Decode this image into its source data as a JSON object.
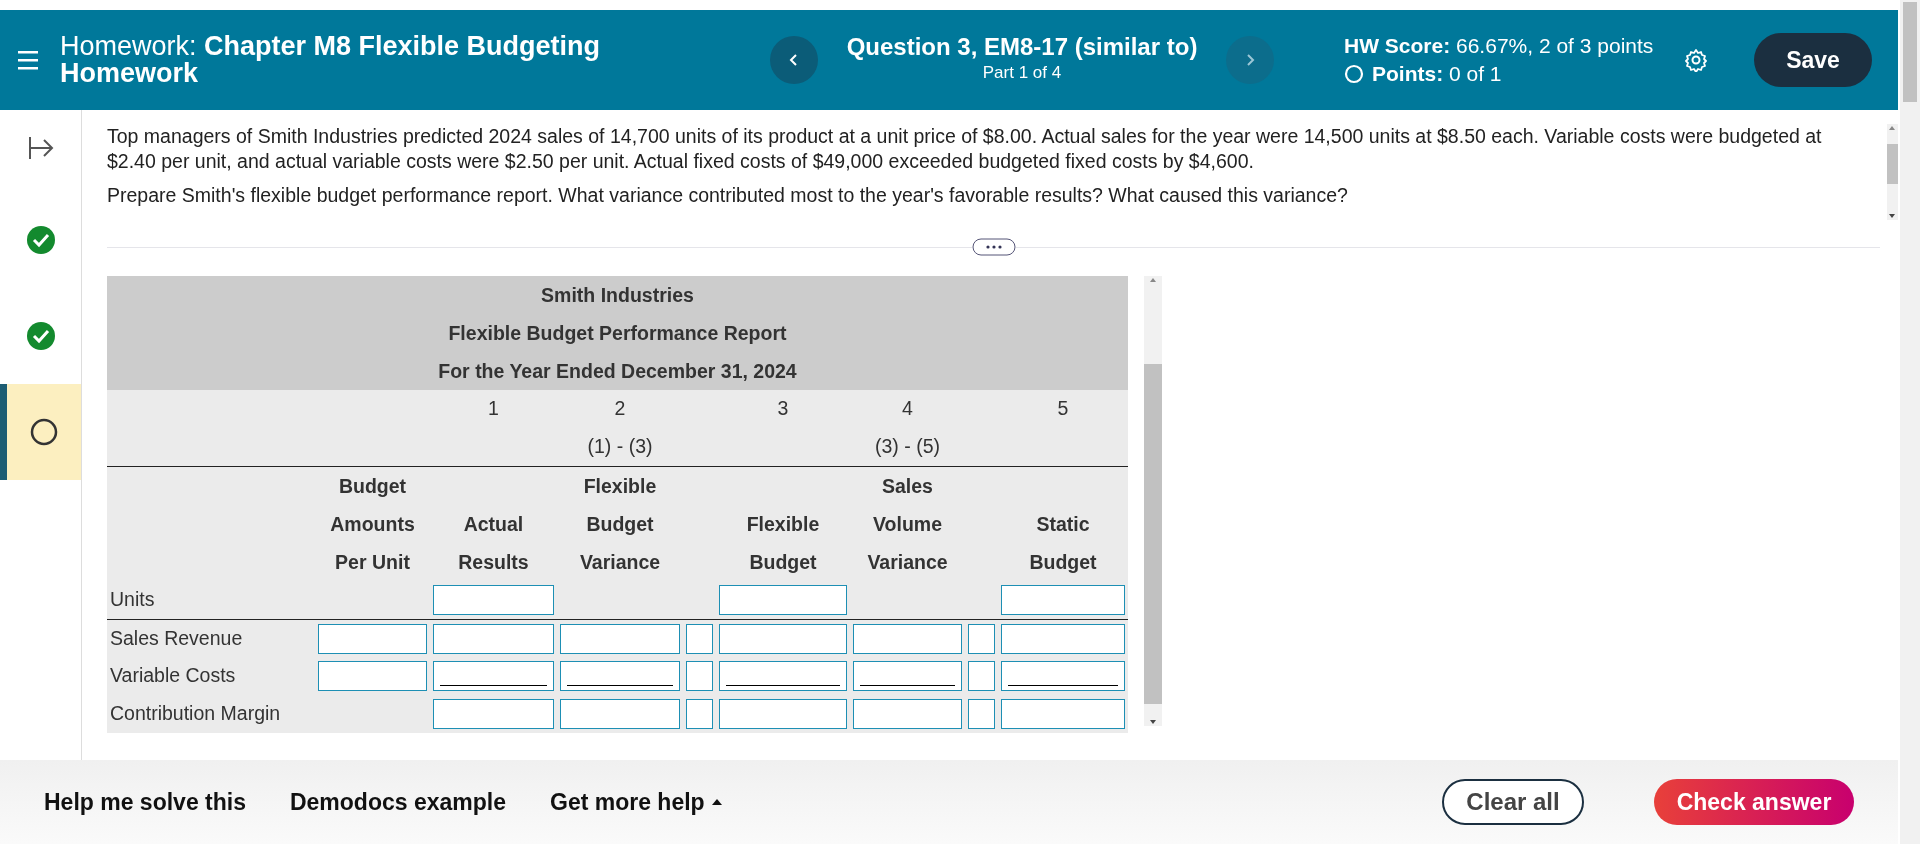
{
  "header": {
    "title_prefix": "Homework:",
    "title": "Chapter M8 Flexible Budgeting Homework",
    "question": "Question 3, EM8-17 (similar to)",
    "part": "Part 1 of 4",
    "score_label": "HW Score:",
    "score_value": "66.67%, 2 of 3 points",
    "points_label": "Points:",
    "points_value": "0 of 1",
    "save": "Save"
  },
  "sidebar": {
    "items": [
      {
        "kind": "check",
        "selected": false
      },
      {
        "kind": "check",
        "selected": false
      },
      {
        "kind": "circle",
        "selected": true
      }
    ]
  },
  "question": {
    "paragraphs": [
      "Top managers of Smith Industries predicted 2024 sales of 14,700 units of its product at a unit price of $8.00. Actual sales for the year were 14,500 units at $8.50 each. Variable costs were budgeted at $2.40 per unit, and actual variable costs were $2.50 per unit. Actual fixed costs of $49,000 exceeded budgeted fixed costs by $4,600.",
      "Prepare Smith's flexible budget performance report. What variance contributed most to the year's favorable results? What caused this variance?"
    ]
  },
  "report": {
    "title_lines": [
      "Smith Industries",
      "Flexible Budget Performance Report",
      "For the Year Ended December 31, 2024"
    ],
    "columns": [
      {
        "heading": [
          "Budget",
          "Amounts",
          "Per Unit"
        ]
      },
      {
        "number": "1",
        "heading": [
          "Actual",
          "Results"
        ]
      },
      {
        "number": "2",
        "formula": "(1) - (3)",
        "heading": [
          "Flexible",
          "Budget",
          "Variance"
        ]
      },
      {
        "number": "3",
        "heading": [
          "Flexible",
          "Budget"
        ]
      },
      {
        "number": "4",
        "formula": "(3) - (5)",
        "heading": [
          "Sales",
          "Volume",
          "Variance"
        ]
      },
      {
        "number": "5",
        "heading": [
          "Static",
          "Budget"
        ]
      }
    ],
    "rows": [
      {
        "label": "Units",
        "cells": [
          {
            "kind": "blank"
          },
          {
            "kind": "field"
          },
          {
            "kind": "blank"
          },
          {
            "kind": "blank"
          },
          {
            "kind": "field"
          },
          {
            "kind": "blank"
          },
          {
            "kind": "blank"
          },
          {
            "kind": "field"
          }
        ]
      },
      {
        "label": "Sales Revenue",
        "cells": [
          {
            "kind": "field"
          },
          {
            "kind": "field"
          },
          {
            "kind": "field"
          },
          {
            "kind": "selector"
          },
          {
            "kind": "field"
          },
          {
            "kind": "field"
          },
          {
            "kind": "selector"
          },
          {
            "kind": "field"
          }
        ]
      },
      {
        "label": "Variable Costs",
        "cells": [
          {
            "kind": "field"
          },
          {
            "kind": "underline"
          },
          {
            "kind": "underline"
          },
          {
            "kind": "selector"
          },
          {
            "kind": "underline"
          },
          {
            "kind": "underline"
          },
          {
            "kind": "selector"
          },
          {
            "kind": "underline"
          }
        ]
      },
      {
        "label": "Contribution Margin",
        "cells": [
          {
            "kind": "blank"
          },
          {
            "kind": "field"
          },
          {
            "kind": "field"
          },
          {
            "kind": "selector"
          },
          {
            "kind": "field"
          },
          {
            "kind": "field"
          },
          {
            "kind": "selector"
          },
          {
            "kind": "field"
          }
        ]
      }
    ]
  },
  "footer": {
    "links": [
      "Help me solve this",
      "Demodocs example",
      "Get more help"
    ],
    "clear": "Clear all",
    "check": "Check answer"
  }
}
